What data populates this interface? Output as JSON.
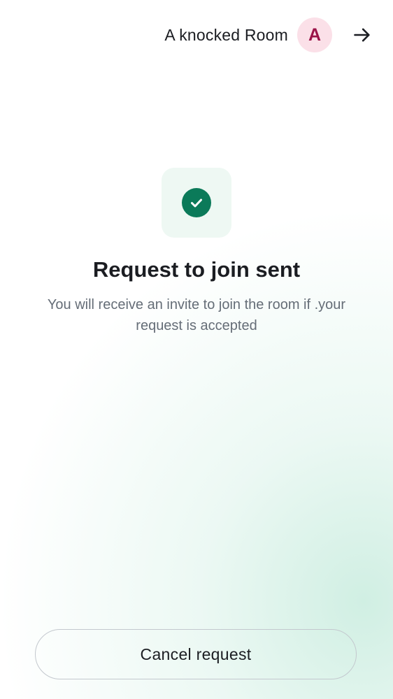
{
  "header": {
    "room_name": "A knocked Room",
    "avatar_initial": "A",
    "avatar_bg": "#fbe0e8",
    "avatar_fg": "#9b1348",
    "forward_icon": "arrow-right-icon"
  },
  "status": {
    "icon": "check-circle-icon",
    "accent": "#0b7a59",
    "title": "Request to join sent",
    "description": "You will receive an invite to join the room if .your request is accepted"
  },
  "actions": {
    "cancel_label": "Cancel request"
  }
}
